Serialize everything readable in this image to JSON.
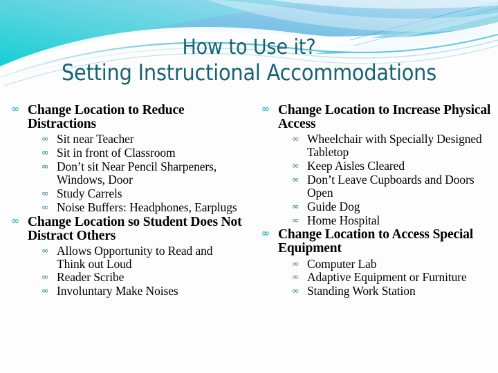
{
  "slide": {
    "title_line_1": "How to Use it?",
    "title_line_2": "Setting Instructional Accommodations",
    "title_color": "#176273",
    "bullet_glyph_level1": "∞",
    "bullet_glyph_level2": "∞",
    "bullet_color_level1": "#2bbfcf",
    "bullet_color_level2": "#3a7b96",
    "background": {
      "accent_cyan": "#2fd2d8",
      "accent_blue": "#7fc4e8",
      "accent_teal": "#3aa8bd",
      "page_white": "#fdfdfd"
    }
  },
  "columns": {
    "left": [
      {
        "heading": "Change Location to Reduce Distractions",
        "sub_items": [
          "Sit near Teacher",
          "Sit in front of Classroom",
          "Don’t sit Near Pencil Sharpeners, Windows, Door",
          "Study Carrels",
          "Noise Buffers: Headphones, Earplugs"
        ]
      },
      {
        "heading": "Change Location so Student Does Not Distract Others",
        "sub_items": [
          "Allows Opportunity to Read and Think out Loud",
          "Reader Scribe",
          "Involuntary Make Noises"
        ]
      }
    ],
    "right": [
      {
        "heading": "Change Location to Increase Physical Access",
        "sub_items": [
          "Wheelchair with Specially Designed Tabletop",
          "Keep Aisles Cleared",
          "Don’t Leave Cupboards and Doors Open",
          "Guide Dog",
          "Home Hospital"
        ]
      },
      {
        "heading": "Change Location to Access Special Equipment",
        "sub_items": [
          "Computer Lab",
          "Adaptive Equipment or Furniture",
          "Standing Work Station"
        ]
      }
    ]
  }
}
